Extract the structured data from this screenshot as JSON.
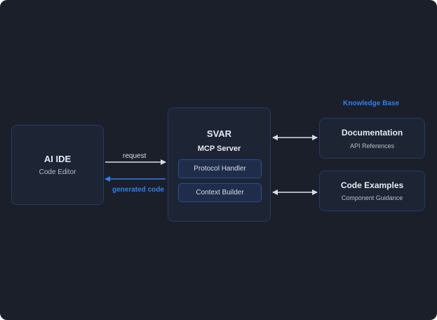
{
  "ai_ide": {
    "title": "AI IDE",
    "subtitle": "Code Editor"
  },
  "mcp_server": {
    "title": "SVAR",
    "subtitle": "MCP Server",
    "modules": [
      "Protocol Handler",
      "Context Builder"
    ]
  },
  "arrows": {
    "request": "request",
    "generated_code": "generated code"
  },
  "knowledge_base": {
    "label": "Knowledge Base",
    "documentation": {
      "title": "Documentation",
      "subtitle": "API References"
    },
    "code_examples": {
      "title": "Code Examples",
      "subtitle": "Component Guidance"
    }
  },
  "colors": {
    "background": "#1b1f29",
    "accent": "#2f7ff0",
    "box_border": "#253a63",
    "arrow": "#d9dde5"
  }
}
